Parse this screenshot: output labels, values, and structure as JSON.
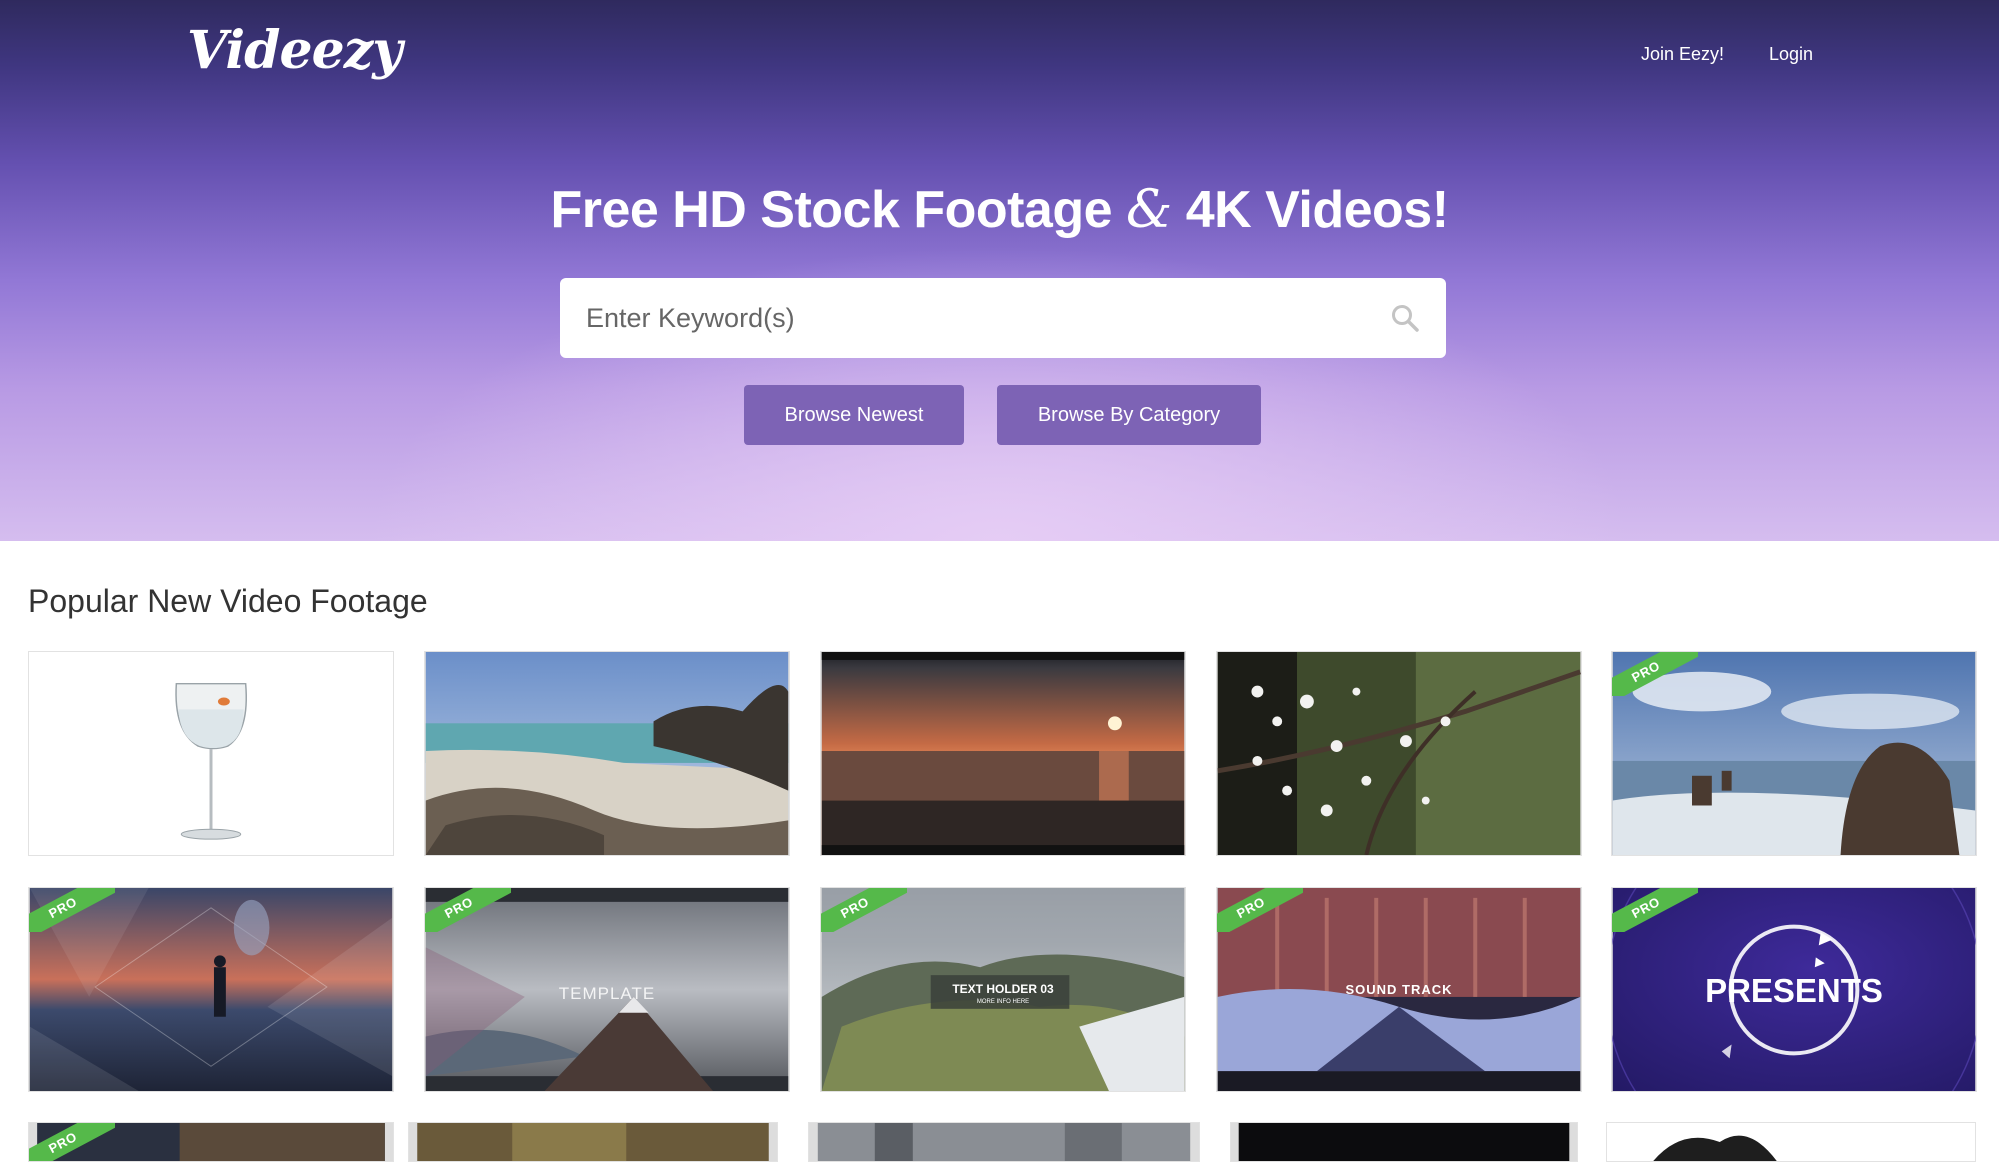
{
  "header": {
    "logo": "Videezy",
    "nav": {
      "join": "Join Eezy!",
      "login": "Login"
    }
  },
  "hero": {
    "title_part1": "Free HD Stock Footage ",
    "title_amp": "&",
    "title_part2": " 4K Videos!",
    "search_placeholder": "Enter Keyword(s)",
    "buttons": {
      "newest": "Browse Newest",
      "category": "Browse By Category"
    }
  },
  "section": {
    "title": "Popular New Video Footage"
  },
  "badges": {
    "pro": "PRO"
  },
  "thumb_texts": {
    "template": "TEMPLATE",
    "text_holder": "TEXT HOLDER 03",
    "more_info": "MORE INFO HERE",
    "sound_track": "SOUND TRACK",
    "presents": "PRESENTS"
  },
  "colors": {
    "pro_green": "#55b94a",
    "button_purple": "#7d63b5",
    "hero_top": "#2f2a5e",
    "hero_bottom": "#d5bdef"
  }
}
